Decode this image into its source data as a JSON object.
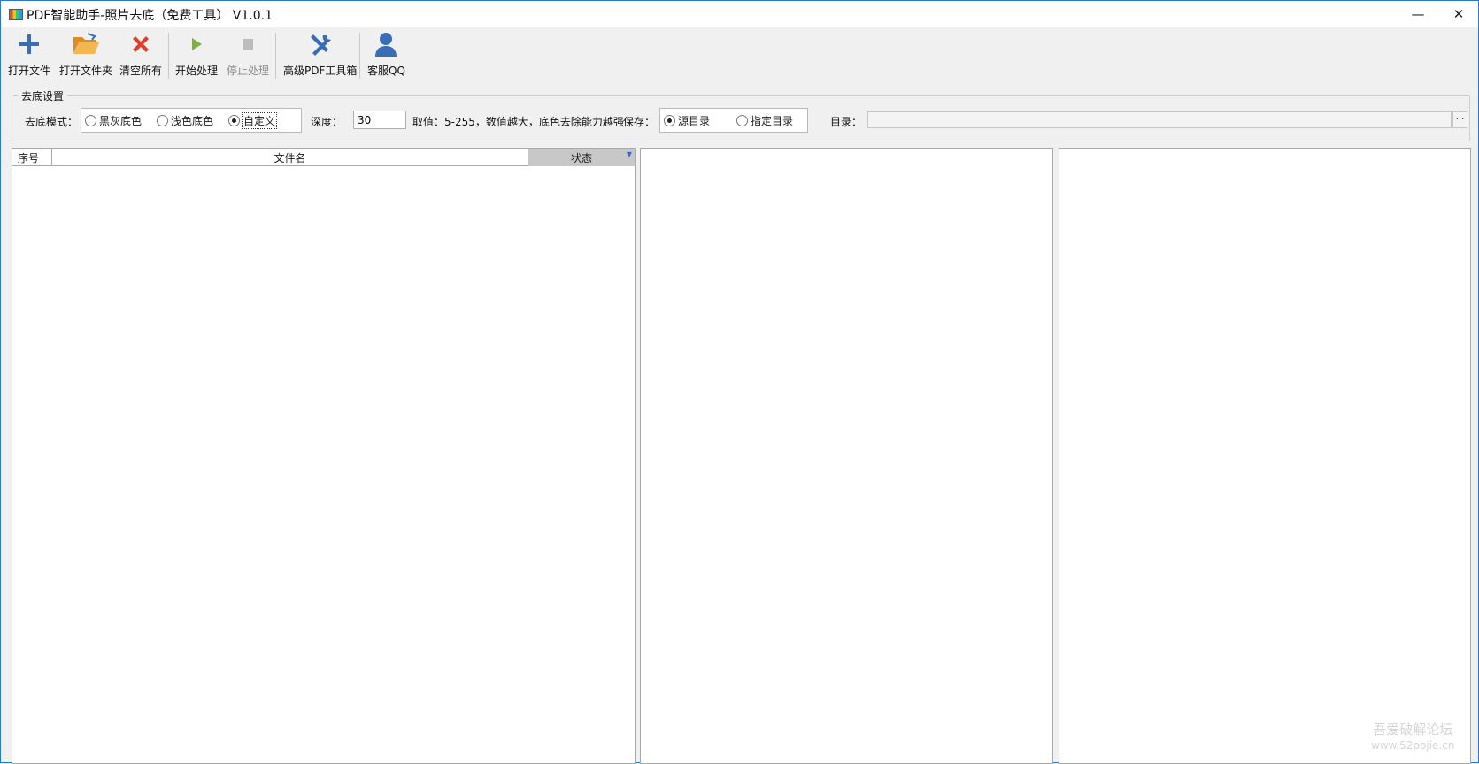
{
  "window": {
    "title": "PDF智能助手-照片去底（免费工具） V1.0.1",
    "minimize_glyph": "—",
    "close_glyph": "✕"
  },
  "toolbar": {
    "open_file": "打开文件",
    "open_folder": "打开文件夹",
    "clear_all": "清空所有",
    "start": "开始处理",
    "stop": "停止处理",
    "pdf_tools": "高级PDF工具箱",
    "support_qq": "客服QQ"
  },
  "settings": {
    "group_title": "去底设置",
    "mode_label": "去底模式：",
    "modes": [
      "黑灰底色",
      "浅色底色",
      "自定义"
    ],
    "selected_mode": "自定义",
    "depth_label": "深度：",
    "depth_value": "30",
    "range_hint": "取值：5-255，数值越大，底色去除能力越强",
    "save_label": "保存：",
    "save_options": [
      "源目录",
      "指定目录"
    ],
    "selected_save": "源目录",
    "dir_label": "目录：",
    "dir_value": "",
    "browse_glyph": "···"
  },
  "file_table": {
    "columns": [
      "序号",
      "文件名",
      "状态"
    ],
    "rows": []
  },
  "watermark": {
    "line1": "吾爱破解论坛",
    "line2": "www.52pojie.cn"
  },
  "colors": {
    "accent_blue": "#3a6db5",
    "delete_red": "#d9412c",
    "play_green": "#7bb43d",
    "folder_orange": "#e9a23b"
  }
}
